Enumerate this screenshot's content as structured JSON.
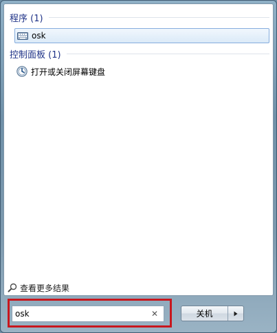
{
  "results": {
    "groups": [
      {
        "title": "程序 (1)",
        "items": [
          {
            "label": "osk",
            "icon": "keyboard-icon"
          }
        ]
      },
      {
        "title": "控制面板 (1)",
        "items": [
          {
            "label": "打开或关闭屏幕键盘",
            "icon": "ease-of-access-icon"
          }
        ]
      }
    ]
  },
  "see_more": {
    "label": "查看更多结果",
    "icon": "search-icon"
  },
  "search": {
    "value": "osk",
    "clear_icon": "close-icon"
  },
  "shutdown": {
    "label": "关机",
    "arrow_icon": "triangle-right-icon"
  },
  "colors": {
    "group_title": "#1e3287",
    "selection_border": "#84acdd",
    "highlight_box": "#c8161d"
  }
}
